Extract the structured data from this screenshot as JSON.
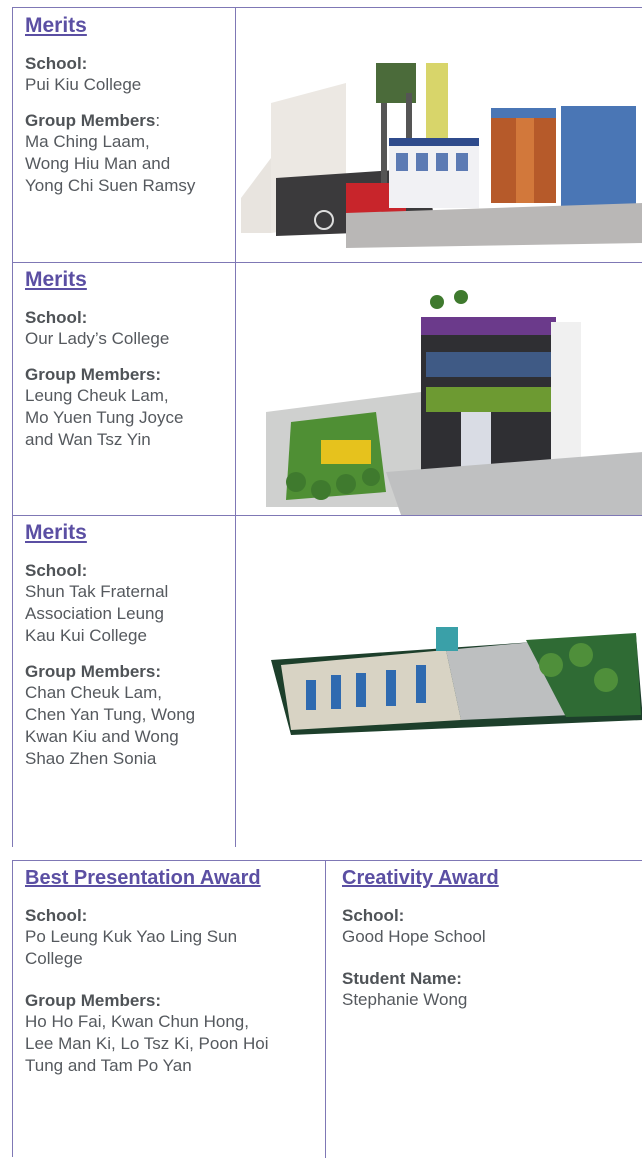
{
  "entries": [
    {
      "award": "Merits",
      "school_label": "School:",
      "school": "Pui Kiu College",
      "members_label": "Group Members",
      "members_suffix": ":",
      "members": [
        "Ma Ching Laam,",
        "Wong Hiu Man and",
        "Yong Chi Suen Ramsy"
      ],
      "photo": "city-model-photo"
    },
    {
      "award": "Merits",
      "school_label": "School:",
      "school": "Our Lady’s College",
      "members_label": "Group Members:",
      "members": [
        "Leung Cheuk Lam,",
        "Mo Yuen Tung Joyce",
        "and Wan Tsz Yin"
      ],
      "photo": "building-model-photo"
    },
    {
      "award": "Merits",
      "school_label": "School:",
      "school_lines": [
        "Shun Tak Fraternal",
        "Association Leung",
        "Kau Kui College"
      ],
      "members_label": "Group Members:",
      "members": [
        "Chan Cheuk Lam,",
        "Chen Yan Tung, Wong",
        "Kwan Kiu and Wong",
        "Shao Zhen Sonia"
      ],
      "photo": "district-model-photo"
    }
  ],
  "awards": [
    {
      "award": "Best Presentation Award",
      "school_label": "School:",
      "school_lines": [
        "Po Leung Kuk Yao Ling Sun",
        "College"
      ],
      "members_label": "Group Members:",
      "members": [
        "Ho Ho Fai, Kwan Chun Hong,",
        "Lee Man Ki, Lo Tsz Ki, Poon Hoi",
        "Tung and Tam Po Yan"
      ]
    },
    {
      "award": "Creativity Award",
      "school_label": "School:",
      "school": "Good Hope School",
      "student_label": "Student Name:",
      "student": "Stephanie Wong"
    }
  ],
  "colors": {
    "accent": "#5b4fa3",
    "border": "#7f78b5",
    "text": "#55595e"
  }
}
